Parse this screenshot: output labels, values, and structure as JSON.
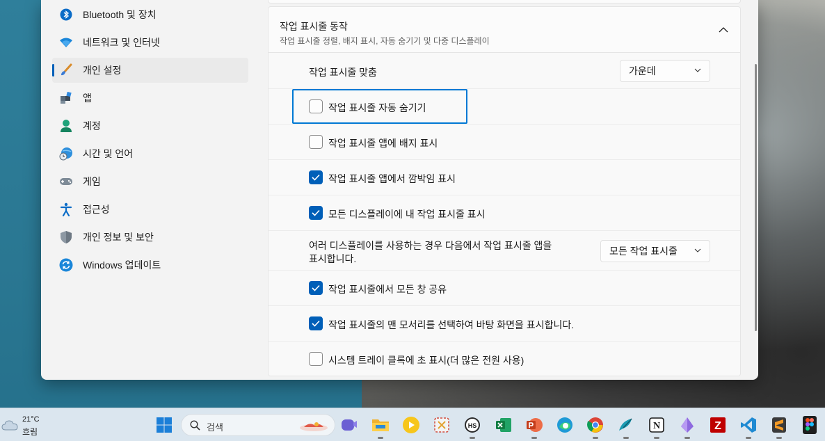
{
  "sidebar": {
    "items": [
      {
        "label": "Bluetooth 및 장치",
        "icon": "bluetooth-icon"
      },
      {
        "label": "네트워크 및 인터넷",
        "icon": "wifi-icon"
      },
      {
        "label": "개인 설정",
        "icon": "brush-icon",
        "active": true
      },
      {
        "label": "앱",
        "icon": "apps-icon"
      },
      {
        "label": "계정",
        "icon": "account-icon"
      },
      {
        "label": "시간 및 언어",
        "icon": "globe-clock-icon"
      },
      {
        "label": "게임",
        "icon": "gamepad-icon"
      },
      {
        "label": "접근성",
        "icon": "accessibility-icon"
      },
      {
        "label": "개인 정보 및 보안",
        "icon": "shield-icon"
      },
      {
        "label": "Windows 업데이트",
        "icon": "update-icon"
      }
    ]
  },
  "behaviors": {
    "title": "작업 표시줄 동작",
    "subtitle": "작업 표시줄 정렬, 배지 표시, 자동 숨기기 및 다중 디스플레이",
    "alignment_label": "작업 표시줄 맞춤",
    "alignment_value": "가운데",
    "auto_hide": {
      "label": "작업 표시줄 자동 숨기기",
      "checked": false
    },
    "badges": {
      "label": "작업 표시줄 앱에 배지 표시",
      "checked": false
    },
    "flashing": {
      "label": "작업 표시줄 앱에서 깜박임 표시",
      "checked": true
    },
    "all_displays": {
      "label": "모든 디스플레이에 내 작업 표시줄 표시",
      "checked": true
    },
    "multi_display_line1": "여러 디스플레이를 사용하는 경우 다음에서 작업 표시줄 앱을",
    "multi_display_line2": "표시합니다.",
    "multi_display_value": "모든 작업 표시줄",
    "share_window": {
      "label": "작업 표시줄에서 모든 창 공유",
      "checked": true
    },
    "far_corner": {
      "label": "작업 표시줄의 맨 모서리를 선택하여 바탕 화면을 표시합니다.",
      "checked": true
    },
    "seconds_clock": {
      "label": "시스템 트레이 클록에 초 표시(더 많은 전원 사용)",
      "checked": false
    }
  },
  "taskbar": {
    "weather_temp": "21°C",
    "weather_cond": "흐림",
    "search_placeholder": "검색",
    "notion_letter": "N",
    "filezilla_letter": "Z"
  },
  "colors": {
    "accent": "#005fb8",
    "focus": "#0078d4"
  }
}
